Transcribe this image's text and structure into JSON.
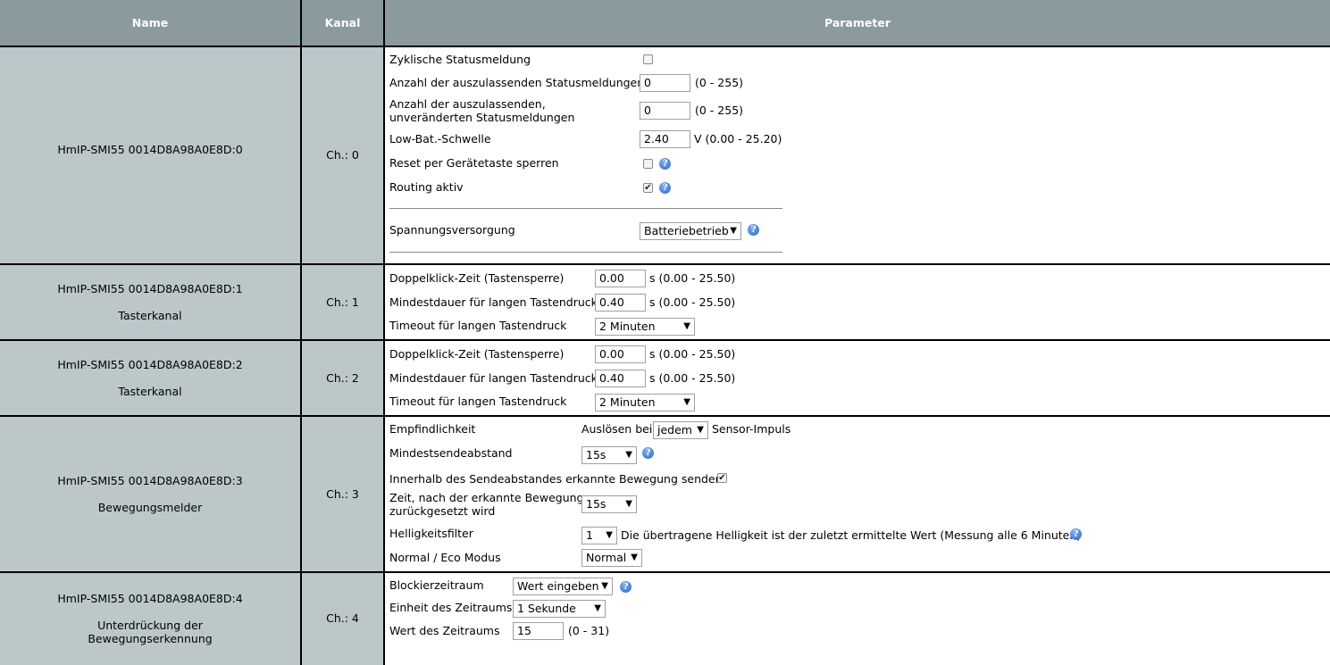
{
  "header": {
    "name": "Name",
    "kanal": "Kanal",
    "parameter": "Parameter"
  },
  "rows": [
    {
      "name": "HmIP-SMI55 0014D8A98A0E8D:0",
      "subtitle": "",
      "channel": "Ch.: 0",
      "params": {
        "cyclic_status_label": "Zyklische Statusmeldung",
        "cyclic_status_checked": false,
        "skip_status_label": "Anzahl der auszulassenden Statusmeldungen",
        "skip_status_value": "0",
        "skip_status_range": "(0 - 255)",
        "skip_unchanged_label_1": "Anzahl der auszulassenden,",
        "skip_unchanged_label_2": "unveränderten Statusmeldungen",
        "skip_unchanged_value": "0",
        "skip_unchanged_range": "(0 - 255)",
        "lowbat_label": "Low-Bat.-Schwelle",
        "lowbat_value": "2.40",
        "lowbat_range": "V (0.00 - 25.20)",
        "reset_lock_label": "Reset per Gerätetaste sperren",
        "reset_lock_checked": false,
        "routing_label": "Routing aktiv",
        "routing_checked": true,
        "power_label": "Spannungsversorgung",
        "power_value": "Batteriebetrieb"
      }
    },
    {
      "name": "HmIP-SMI55 0014D8A98A0E8D:1",
      "subtitle": "Tasterkanal",
      "channel": "Ch.: 1",
      "params": {
        "dblclick_label": "Doppelklick-Zeit (Tastensperre)",
        "dblclick_value": "0.00",
        "dblclick_range": "s (0.00 - 25.50)",
        "longpress_label": "Mindestdauer für langen Tastendruck",
        "longpress_value": "0.40",
        "longpress_range": "s (0.00 - 25.50)",
        "timeout_label": "Timeout für langen Tastendruck",
        "timeout_value": "2 Minuten"
      }
    },
    {
      "name": "HmIP-SMI55 0014D8A98A0E8D:2",
      "subtitle": "Tasterkanal",
      "channel": "Ch.: 2",
      "params": {
        "dblclick_label": "Doppelklick-Zeit (Tastensperre)",
        "dblclick_value": "0.00",
        "dblclick_range": "s (0.00 - 25.50)",
        "longpress_label": "Mindestdauer für langen Tastendruck",
        "longpress_value": "0.40",
        "longpress_range": "s (0.00 - 25.50)",
        "timeout_label": "Timeout für langen Tastendruck",
        "timeout_value": "2 Minuten"
      }
    },
    {
      "name": "HmIP-SMI55 0014D8A98A0E8D:3",
      "subtitle": "Bewegungsmelder",
      "channel": "Ch.: 3",
      "params": {
        "sensitivity_label": "Empfindlichkeit",
        "sensitivity_prefix": "Auslösen bei",
        "sensitivity_value": "jedem",
        "sensitivity_suffix": "Sensor-Impuls",
        "min_interval_label": "Mindestsendeabstand",
        "min_interval_value": "15s",
        "within_interval_label": "Innerhalb des Sendeabstandes erkannte Bewegung senden",
        "within_interval_checked": true,
        "reset_time_label_1": "Zeit, nach der erkannte Bewegung",
        "reset_time_label_2": "zurückgesetzt wird",
        "reset_time_value": "15s",
        "brightness_label": "Helligkeitsfilter",
        "brightness_value": "1",
        "brightness_note": "Die übertragene Helligkeit ist der zuletzt ermittelte Wert (Messung alle 6 Minuten)",
        "eco_label": "Normal / Eco Modus",
        "eco_value": "Normal"
      }
    },
    {
      "name": "HmIP-SMI55 0014D8A98A0E8D:4",
      "subtitle_1": "Unterdrückung der",
      "subtitle_2": "Bewegungserkennung",
      "channel": "Ch.: 4",
      "params": {
        "block_label": "Blockierzeitraum",
        "block_value": "Wert eingeben",
        "unit_label": "Einheit des Zeitraums",
        "unit_value": "1 Sekunde",
        "value_label": "Wert des Zeitraums",
        "value_value": "15",
        "value_range": "(0 - 31)"
      }
    }
  ],
  "icons": {
    "help": "help-icon",
    "check": "✔",
    "dropdown": "▼",
    "help_glyph": "?"
  }
}
